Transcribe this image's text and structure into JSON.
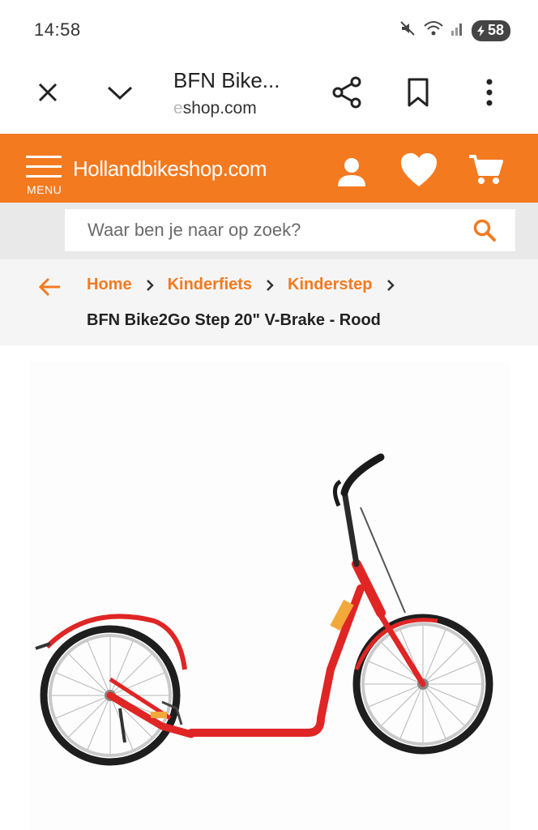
{
  "status_bar": {
    "time": "14:58",
    "battery": "58",
    "icons": [
      "mute-icon",
      "wifi-icon",
      "signal-icon",
      "battery-icon"
    ]
  },
  "browser": {
    "page_title": "BFN Bike...",
    "domain_faded": "e",
    "domain": "shop.com",
    "icons": [
      "close-icon",
      "chevron-down-icon",
      "share-icon",
      "bookmark-icon",
      "more-icon"
    ]
  },
  "site_header": {
    "menu_label": "MENU",
    "logo_text": "Hollandbikeshop.com",
    "brand_color": "#f47a20",
    "icons": [
      "account-icon",
      "wishlist-heart-icon",
      "cart-icon"
    ]
  },
  "search": {
    "placeholder": "Waar ben je naar op zoek?"
  },
  "breadcrumb": {
    "items": [
      "Home",
      "Kinderfiets",
      "Kinderstep"
    ],
    "current": "BFN Bike2Go Step 20\" V-Brake - Rood"
  },
  "product": {
    "image_subject": "red-kick-scooter",
    "frame_color": "#e02525"
  }
}
